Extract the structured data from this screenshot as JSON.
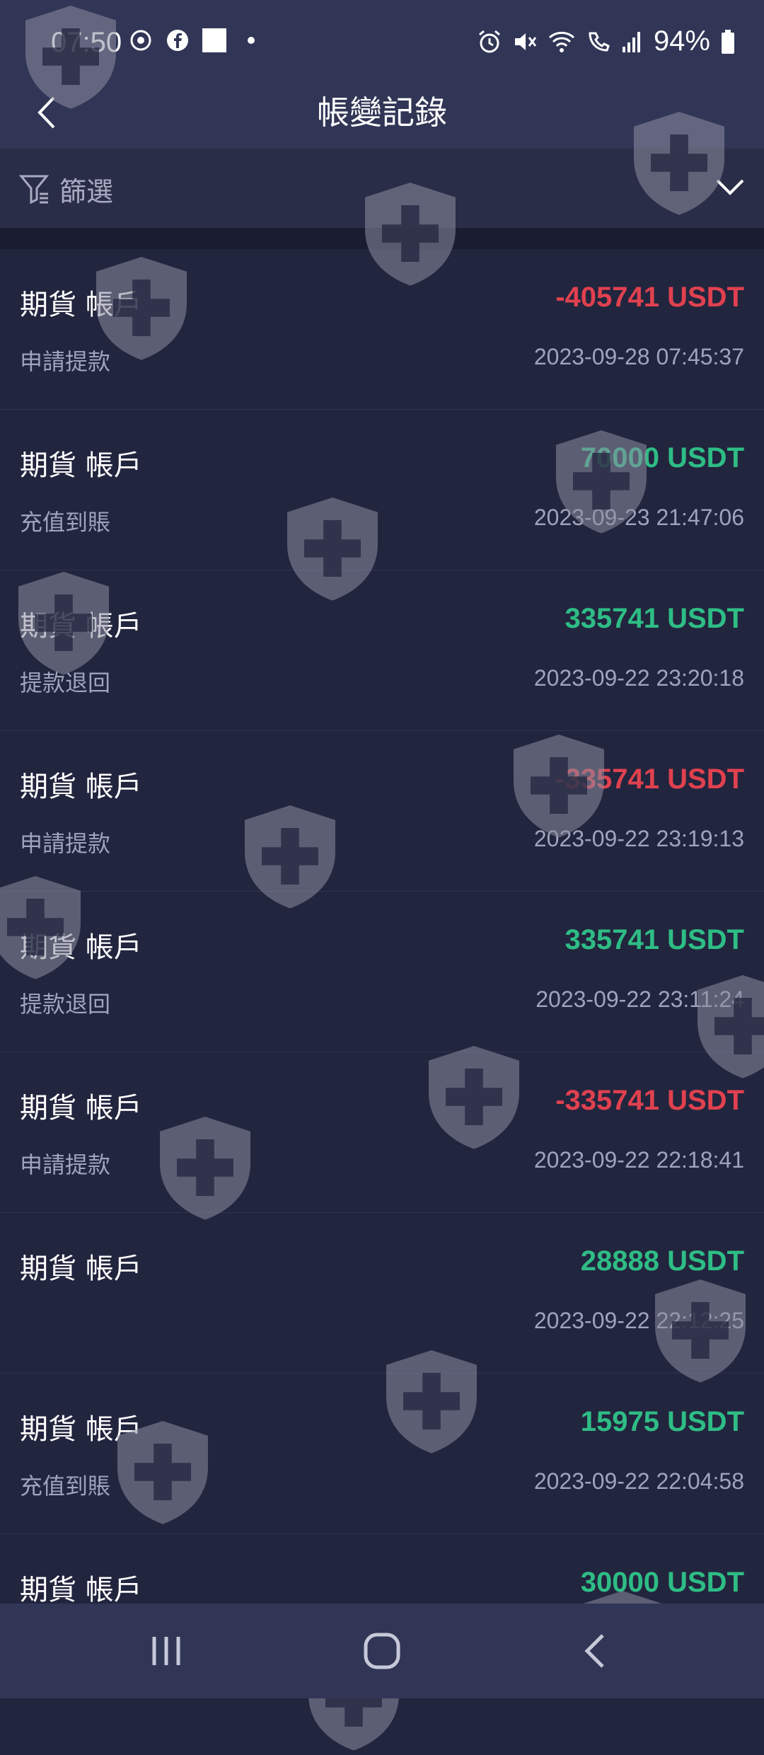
{
  "status_bar": {
    "time": "07:50",
    "battery": "94%",
    "left_icons": [
      "camera-ring-icon",
      "facebook-icon",
      "white-square-icon",
      "dot-icon"
    ],
    "right_icons": [
      "alarm-icon",
      "mute-icon",
      "wifi-icon",
      "wifi-call-icon",
      "signal-icon",
      "battery-icon"
    ]
  },
  "header": {
    "title": "帳變記錄",
    "back_icon": "chevron-left-icon"
  },
  "filter": {
    "label": "篩選",
    "icon": "filter-icon",
    "chevron": "chevron-down-icon"
  },
  "records": [
    {
      "account": "期貨 帳戶",
      "type": "申請提款",
      "amount": "-405741 USDT",
      "sign": "neg",
      "date": "2023-09-28 07:45:37"
    },
    {
      "account": "期貨 帳戶",
      "type": "充值到賬",
      "amount": "70000 USDT",
      "sign": "pos",
      "date": "2023-09-23 21:47:06"
    },
    {
      "account": "期貨 帳戶",
      "type": "提款退回",
      "amount": "335741 USDT",
      "sign": "pos",
      "date": "2023-09-22 23:20:18"
    },
    {
      "account": "期貨 帳戶",
      "type": "申請提款",
      "amount": "-335741 USDT",
      "sign": "neg",
      "date": "2023-09-22 23:19:13"
    },
    {
      "account": "期貨 帳戶",
      "type": "提款退回",
      "amount": "335741 USDT",
      "sign": "pos",
      "date": "2023-09-22 23:11:24"
    },
    {
      "account": "期貨 帳戶",
      "type": "申請提款",
      "amount": "-335741 USDT",
      "sign": "neg",
      "date": "2023-09-22 22:18:41"
    },
    {
      "account": "期貨 帳戶",
      "type": "",
      "amount": "28888 USDT",
      "sign": "pos",
      "date": "2023-09-22 22:12:25"
    },
    {
      "account": "期貨 帳戶",
      "type": "充值到賬",
      "amount": "15975 USDT",
      "sign": "pos",
      "date": "2023-09-22 22:04:58"
    },
    {
      "account": "期貨 帳戶",
      "type": "",
      "amount": "30000 USDT",
      "sign": "pos",
      "date": ""
    }
  ],
  "nav_bar": {
    "recents_icon": "recents-icon",
    "home_icon": "home-icon",
    "back_icon": "back-icon"
  },
  "colors": {
    "background": "#22253e",
    "header": "#313656",
    "negative": "#e0414f",
    "positive": "#2ebd85",
    "muted_text": "#9fa3bb"
  },
  "watermark_icon": "shield-plus-icon"
}
